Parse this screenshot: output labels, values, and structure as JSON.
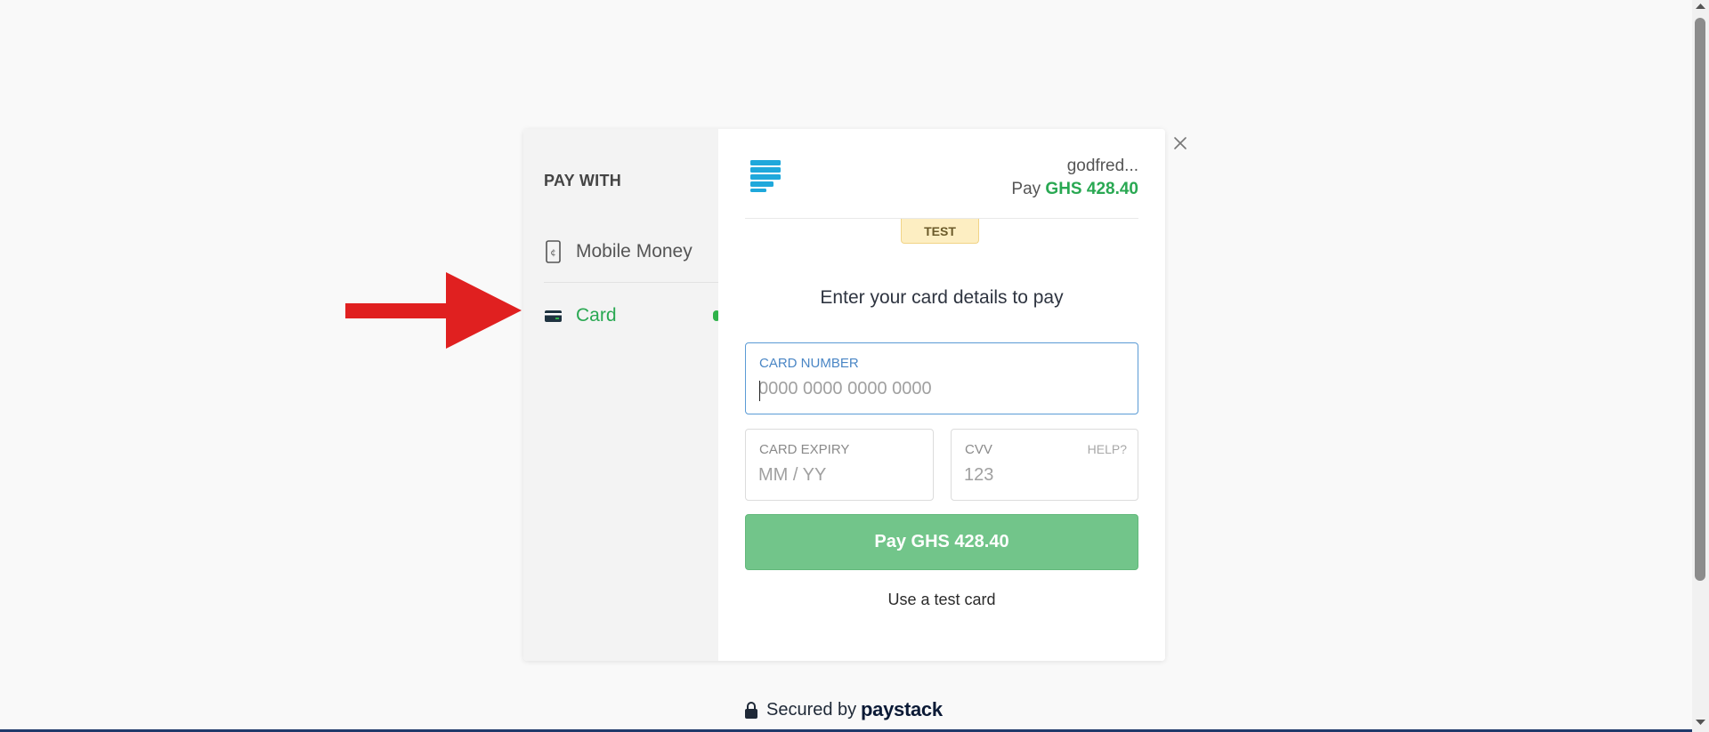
{
  "sidebar": {
    "heading": "PAY WITH",
    "methods": [
      {
        "label": "Mobile Money",
        "icon": "mobile-phone-icon",
        "active": false
      },
      {
        "label": "Card",
        "icon": "credit-card-icon",
        "active": true
      }
    ]
  },
  "header": {
    "merchant_name": "godfred...",
    "pay_prefix": "Pay",
    "amount": "GHS 428.40"
  },
  "test_badge": "TEST",
  "form": {
    "prompt": "Enter your card details to pay",
    "card_number": {
      "label": "CARD NUMBER",
      "placeholder": "0000 0000 0000 0000",
      "value": ""
    },
    "card_expiry": {
      "label": "CARD EXPIRY",
      "placeholder": "MM / YY",
      "value": ""
    },
    "cvv": {
      "label": "CVV",
      "placeholder": "123",
      "help": "HELP?",
      "value": ""
    },
    "pay_button": "Pay GHS 428.40",
    "test_card_link": "Use a test card"
  },
  "footer": {
    "secured_text": "Secured by",
    "brand": "paystack"
  },
  "colors": {
    "accent_green": "#29a852",
    "pay_button": "#72c58a",
    "focus_blue": "#5b9bd5",
    "annotation_arrow": "#e02020"
  }
}
